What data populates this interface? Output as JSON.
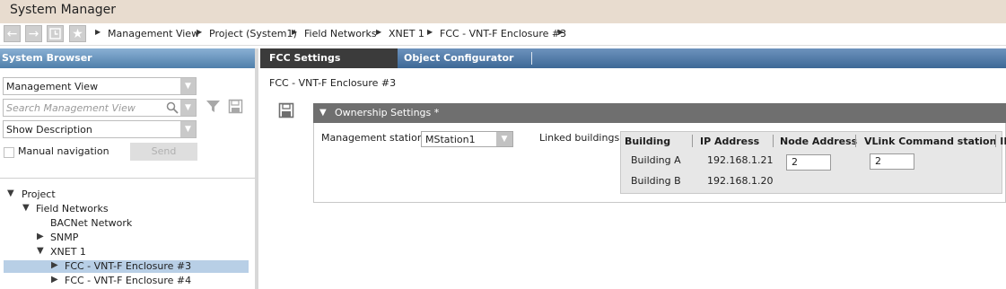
{
  "app": {
    "title": "System Manager"
  },
  "breadcrumb": [
    "Management View",
    "Project (System1)",
    "Field Networks",
    "XNET 1",
    "FCC - VNT-F Enclosure #3"
  ],
  "system_browser": {
    "header": "System Browser",
    "view_select": "Management View",
    "search_placeholder": "Search Management View",
    "description_select": "Show Description",
    "manual_navigation_label": "Manual navigation",
    "send_label": "Send",
    "tree": [
      {
        "label": "Project",
        "expanded": true
      },
      {
        "label": "Field Networks",
        "expanded": true
      },
      {
        "label": "BACNet Network"
      },
      {
        "label": "SNMP",
        "expanded": false
      },
      {
        "label": "XNET 1",
        "expanded": true
      },
      {
        "label": "FCC - VNT-F Enclosure #3",
        "selected": true
      },
      {
        "label": "FCC - VNT-F Enclosure #4"
      }
    ]
  },
  "tabs": {
    "active": "FCC Settings",
    "other": "Object Configurator"
  },
  "main": {
    "object_title": "FCC - VNT-F Enclosure #3",
    "section_title": "Ownership Settings *",
    "management_station_label": "Management station:",
    "management_station_value": "MStation1",
    "linked_buildings_label": "Linked buildings:",
    "columns": [
      "Building",
      "IP Address",
      "Node Address",
      "VLink Command station ID"
    ],
    "rows": [
      {
        "building": "Building A",
        "ip": "192.168.1.21",
        "node": "2",
        "vlink": "2"
      },
      {
        "building": "Building B",
        "ip": "192.168.1.20"
      }
    ]
  },
  "colors": {
    "tab_blue": "#4f7faa",
    "selection": "#b8cfe6",
    "section_header": "#6f6f6f"
  }
}
